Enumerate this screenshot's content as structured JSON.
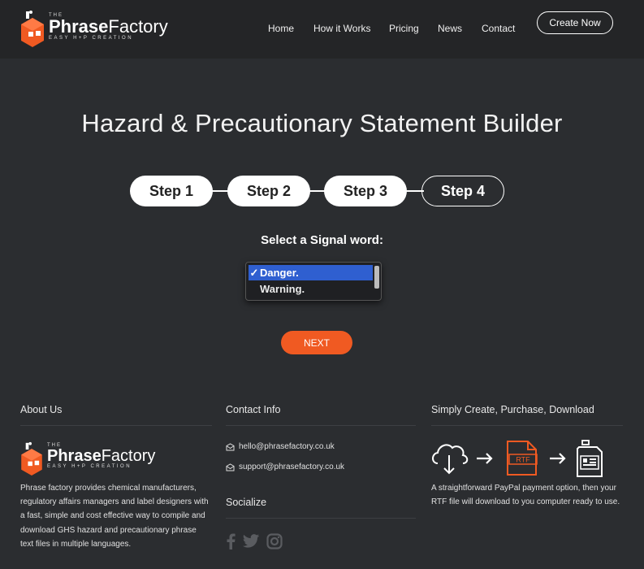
{
  "brand": {
    "the": "THE",
    "name_bold": "Phrase",
    "name_rest": "Factory",
    "tagline": "EASY H+P CREATION",
    "accent": "#f05a22"
  },
  "nav": {
    "items": [
      "Home",
      "How it Works",
      "Pricing",
      "News",
      "Contact"
    ],
    "cta": "Create Now"
  },
  "main": {
    "title": "Hazard & Precautionary Statement Builder",
    "steps": [
      "Step 1",
      "Step 2",
      "Step 3",
      "Step 4"
    ],
    "active_step": 4,
    "signal_label": "Select a Signal word:",
    "signal_options": [
      {
        "label": "Danger.",
        "selected": true
      },
      {
        "label": "Warning.",
        "selected": false
      }
    ],
    "check_mark": "✓",
    "next_label": "NEXT"
  },
  "footer": {
    "about": {
      "title": "About Us",
      "text": "Phrase factory provides chemical manufacturers, regulatory affairs managers and label designers with a fast, simple and cost effective way to compile and download GHS hazard and precautionary phrase text files in multiple languages."
    },
    "contact": {
      "title": "Contact Info",
      "emails": [
        "hello@phrasefactory.co.uk",
        "support@phrasefactory.co.uk"
      ],
      "socialize_title": "Socialize",
      "social_icons": [
        "facebook-icon",
        "twitter-icon",
        "instagram-icon"
      ]
    },
    "simple": {
      "title": "Simply Create, Purchase, Download",
      "rtf_label": "RTF",
      "text": "A straightforward PayPal payment option, then your RTF file will download to you computer ready to use."
    }
  }
}
